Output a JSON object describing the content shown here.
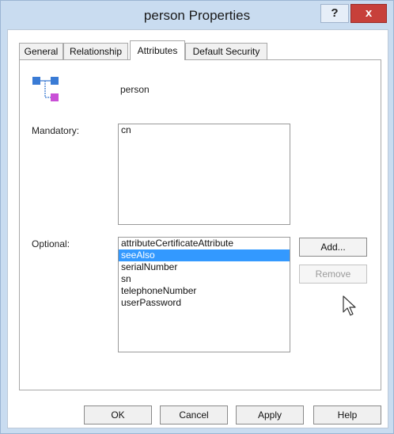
{
  "window": {
    "title": "person Properties",
    "help_label": "?",
    "close_label": "x"
  },
  "tabs": [
    {
      "label": "General"
    },
    {
      "label": "Relationship"
    },
    {
      "label": "Attributes",
      "active": true
    },
    {
      "label": "Default Security"
    }
  ],
  "object": {
    "name": "person",
    "icon": "class-icon"
  },
  "mandatory": {
    "label": "Mandatory:",
    "items": [
      "cn"
    ]
  },
  "optional": {
    "label": "Optional:",
    "items": [
      "attributeCertificateAttribute",
      "seeAlso",
      "serialNumber",
      "sn",
      "telephoneNumber",
      "userPassword"
    ],
    "selected": "seeAlso"
  },
  "side_buttons": {
    "add": "Add...",
    "remove": "Remove"
  },
  "buttons": {
    "ok": "OK",
    "cancel": "Cancel",
    "apply": "Apply",
    "help": "Help"
  },
  "colors": {
    "selection": "#3399ff",
    "close": "#c7403a",
    "frame": "#c9dcf0"
  }
}
